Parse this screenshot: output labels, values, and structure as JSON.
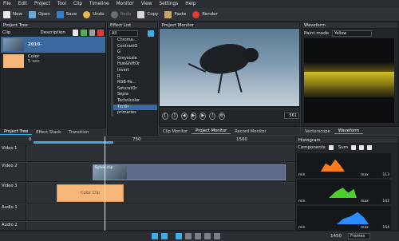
{
  "menu": [
    "File",
    "Edit",
    "Project",
    "Tool",
    "Clip",
    "Timeline",
    "Monitor",
    "View",
    "Settings",
    "Help"
  ],
  "toolbar": {
    "new": "New",
    "open": "Open",
    "save": "Save",
    "undo": "Undo",
    "redo": "Redo",
    "copy": "Copy",
    "paste": "Paste",
    "render": "Render"
  },
  "project_tree": {
    "title": "Project Tree",
    "col_clip": "Clip",
    "col_desc": "Description",
    "items": [
      {
        "name": "2010-",
        "sub": ""
      },
      {
        "name": "Color",
        "sub": "5 sec"
      }
    ],
    "tabs": [
      "Project Tree",
      "Effect Stack",
      "Transition"
    ]
  },
  "effect_list": {
    "title": "Effect List",
    "filter": "All",
    "items": [
      "Chroma...",
      "ContrastO",
      "G",
      "Greyscale",
      "Hue&hiftOr",
      "Invert",
      "R",
      "RGB-Pa...",
      "SaturatOr",
      "Sepia",
      "Technicolor",
      "Tint0r",
      "primaries"
    ]
  },
  "monitor": {
    "title": "Project Monitor",
    "timecode": "561",
    "tabs": [
      "Clip Monitor",
      "Project Monitor",
      "Record Monitor"
    ]
  },
  "waveform": {
    "title": "Waveform",
    "paint_mode_label": "Paint mode",
    "paint_mode_value": "Yellow",
    "tabs": [
      "Vectorscope",
      "Waveform"
    ]
  },
  "histogram": {
    "title": "Histogram",
    "components_label": "Components",
    "sum_label": "Sum",
    "rows": [
      {
        "min": "min",
        "max": "max",
        "max_val": "113",
        "color": "#ff7a1a"
      },
      {
        "min": "min",
        "max": "max",
        "max_val": "142",
        "color": "#4ccf2a"
      },
      {
        "min": "min",
        "max": "max",
        "max_val": "154",
        "color": "#2a8cff"
      }
    ]
  },
  "ruler": {
    "ticks": [
      "0",
      "750",
      "1500"
    ]
  },
  "tracks": [
    "Video 1",
    "Video 2",
    "Video 3",
    "Audio 1",
    "Audio 2"
  ],
  "clips": {
    "video2": "Sylvie clip",
    "video3": "Color Clip"
  },
  "statusbar": {
    "frame": "1450",
    "unit": "Frames"
  }
}
